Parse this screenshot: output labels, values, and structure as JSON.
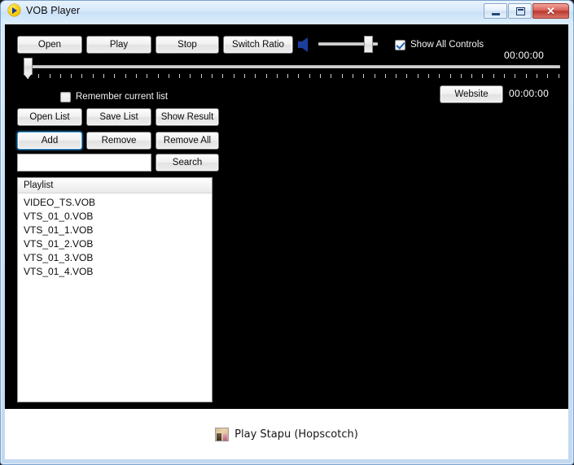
{
  "window": {
    "title": "VOB Player",
    "app_icon": "play-circle-icon",
    "minimize_label": "",
    "maximize_label": "",
    "close_label": "✕"
  },
  "toolbar": {
    "open": "Open",
    "play": "Play",
    "stop": "Stop",
    "switch_ratio": "Switch Ratio",
    "volume_icon": "speaker-icon",
    "volume_value": 88,
    "show_all_controls": {
      "label": "Show All Controls",
      "checked": true
    },
    "timecode": "00:00:00"
  },
  "seekbar": {
    "position": 0
  },
  "options": {
    "remember_current_list": {
      "label": "Remember current list",
      "checked": false
    },
    "website": "Website",
    "timecode": "00:00:00"
  },
  "playlist_controls": {
    "open_list": "Open List",
    "save_list": "Save List",
    "show_result": "Show Result",
    "add": "Add",
    "remove": "Remove",
    "remove_all": "Remove All",
    "search": "Search",
    "search_value": "",
    "search_placeholder": ""
  },
  "playlist": {
    "header": "Playlist",
    "items": [
      "VIDEO_TS.VOB",
      "VTS_01_0.VOB",
      "VTS_01_1.VOB",
      "VTS_01_2.VOB",
      "VTS_01_3.VOB",
      "VTS_01_4.VOB"
    ]
  },
  "statusbar": {
    "thumbnail_icon": "game-thumbnail-icon",
    "text": "Play Stapu (Hopscotch)"
  },
  "colors": {
    "accent": "#3c9ada",
    "titlebar": "#cbe1f8",
    "client_bg": "#000000",
    "close_button": "#bb392f",
    "checkbox_check": "#2166b3",
    "speaker": "#1a3fa0"
  }
}
